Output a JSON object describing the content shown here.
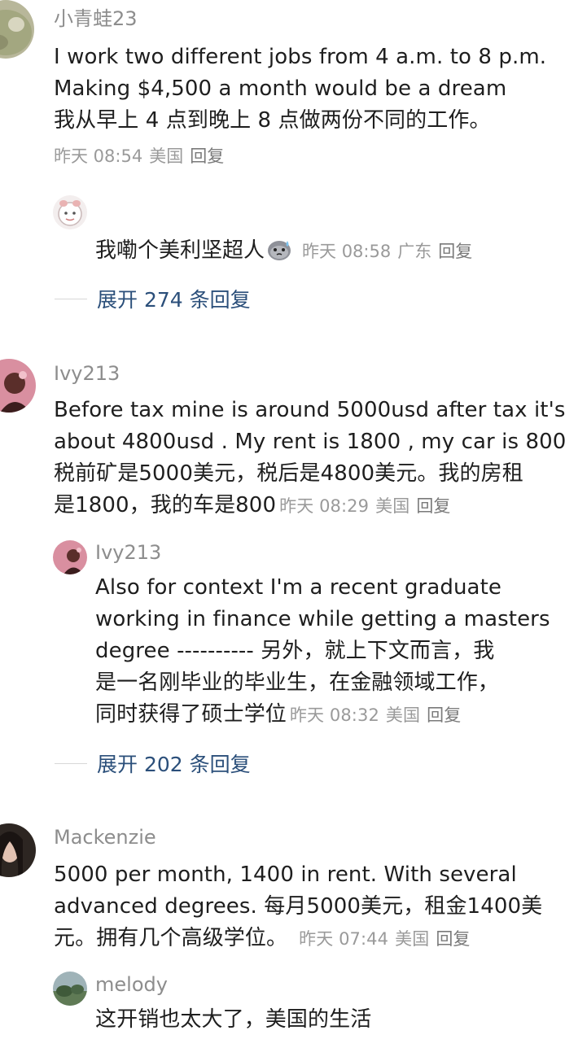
{
  "comments": [
    {
      "user": "小青蛙23",
      "lines": [
        "I work two different jobs from 4 a.m. to 8 p.m.",
        "Making $4,500 a month would be a dream",
        "我从早上 4 点到晚上 8 点做两份不同的工作。"
      ],
      "time": "昨天 08:54",
      "location": "美国",
      "reply": "回复"
    },
    {
      "user": "Ivy213",
      "lines": [
        "Before tax mine is around 5000usd after tax it's",
        "about 4800usd . My rent is 1800 , my car is 800",
        "税前矿是5000美元，税后是4800美元。我的房租",
        "是1800，我的车是800"
      ],
      "time": "昨天 08:29",
      "location": "美国",
      "reply": "回复"
    },
    {
      "user": "Mackenzie",
      "lines": [
        "5000 per month, 1400 in rent. With several",
        "advanced degrees. 每月5000美元，租金1400美",
        "元。拥有几个高级学位。"
      ],
      "time": "昨天 07:44",
      "location": "美国",
      "reply": "回复"
    }
  ],
  "replies": [
    {
      "text": "我嘞个美利坚超人",
      "emoji": "sweat-face-emoji",
      "time": "昨天 08:58",
      "location": "广东",
      "reply": "回复"
    },
    {
      "user": "Ivy213",
      "lines": [
        "Also for context I'm a recent graduate",
        "working in finance while getting a masters",
        "degree ---------- 另外，就上下文而言，我",
        "是一名刚毕业的毕业生，在金融领域工作，",
        "同时获得了硕士学位"
      ],
      "time": "昨天 08:32",
      "location": "美国",
      "reply": "回复"
    },
    {
      "user": "melody",
      "lines": [
        "这开销也太大了，美国的生活"
      ]
    }
  ],
  "expands": [
    "展开 274 条回复",
    "展开 202 条回复"
  ],
  "colors": {
    "username": "#8d8d8d",
    "meta": "#9a9a9a",
    "expand": "#2b4f7a",
    "text": "#1e1e1e"
  }
}
